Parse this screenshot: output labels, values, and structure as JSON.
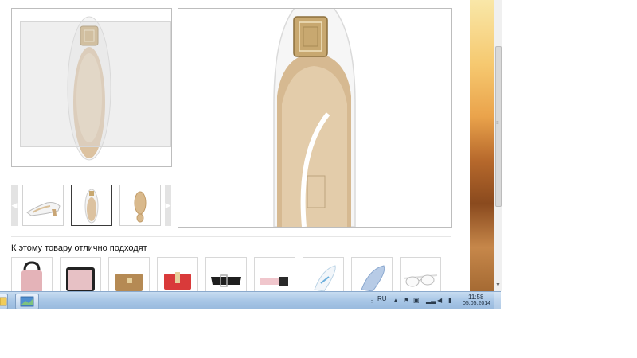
{
  "related": {
    "title": "К этому товару отлично подходят",
    "items": [
      {
        "icon": "pink-bag-icon"
      },
      {
        "icon": "pink-laptop-case-icon"
      },
      {
        "icon": "brown-clutch-icon"
      },
      {
        "icon": "red-wallet-icon"
      },
      {
        "icon": "black-belt-icon"
      },
      {
        "icon": "pink-belt-icon"
      },
      {
        "icon": "white-shoe-insole-icon"
      },
      {
        "icon": "blue-shoe-insole-icon"
      },
      {
        "icon": "white-sunglasses-icon"
      }
    ]
  },
  "thumbnails": [
    {
      "icon": "shoe-side-view-icon"
    },
    {
      "icon": "shoe-top-view-icon",
      "selected": true
    },
    {
      "icon": "shoe-sole-view-icon"
    }
  ],
  "taskbar": {
    "language": "RU",
    "time": "11:58",
    "date": "05.05.2014"
  },
  "colors": {
    "taskbar": "#a8c6e6",
    "border": "#bdbdbd",
    "shoe_white": "#f4f4f4",
    "shoe_inner": "#dcc2a0",
    "buckle_gold": "#c8a870"
  }
}
